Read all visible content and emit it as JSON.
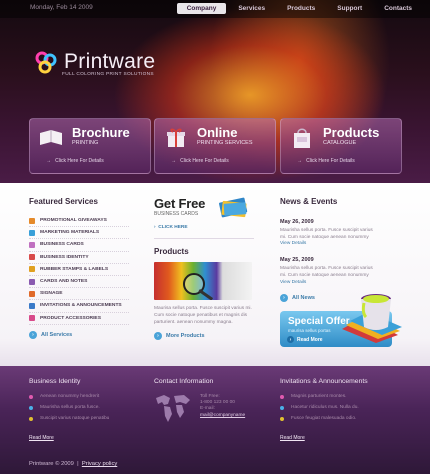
{
  "header": {
    "date": "Monday, Feb 14 2009",
    "nav": [
      "Company",
      "Services",
      "Products",
      "Support",
      "Contacts"
    ],
    "logo_name": "Printware",
    "logo_tagline": "FULL COLORING PRINT SOLUTIONS",
    "promos": [
      {
        "title": "Brochure",
        "subtitle": "PRINTING",
        "link": "Click Here For Details",
        "icon": "book-icon"
      },
      {
        "title": "Online",
        "subtitle": "PRINTING SERVICES",
        "link": "Click Here For Details",
        "icon": "gift-box-icon"
      },
      {
        "title": "Products",
        "subtitle": "CATALOGUE",
        "link": "Click Here For Details",
        "icon": "shopping-bag-icon"
      }
    ]
  },
  "featured": {
    "title": "Featured Services",
    "items": [
      {
        "label": "PROMOTIONAL GIVEAWAYS",
        "color": "#e58a2a"
      },
      {
        "label": "MARKETING MATERIALS",
        "color": "#3aa0d8"
      },
      {
        "label": "BUSINESS CARDS",
        "color": "#c070c0"
      },
      {
        "label": "BUSINESS IDENTITY",
        "color": "#d84a4a"
      },
      {
        "label": "RUBBER STAMPS & LABELS",
        "color": "#e0a020"
      },
      {
        "label": "CARDS AND NOTES",
        "color": "#8a5ab0"
      },
      {
        "label": "SIGNAGE",
        "color": "#e06a2a"
      },
      {
        "label": "INVITATIONS & ANNOUNCEMENTS",
        "color": "#3a7ac8"
      },
      {
        "label": "PRODUCT ACCESSORIES",
        "color": "#d84a8a"
      }
    ],
    "more": "All Services"
  },
  "getfree": {
    "title": "Get Free",
    "subtitle": "BUSINESS CARDS",
    "link": "CLICK HERE"
  },
  "products": {
    "title": "Products",
    "text": "Maurisa sellus porta. Fusce suscipit varius mi. Cum socie natoque penatibus et magnis dis parturient. aenean nonummy magna.",
    "more": "More Products"
  },
  "news": {
    "title": "News & Events",
    "items": [
      {
        "date": "May 26, 2009",
        "text": "Maurisha sellus porta. Fusce suscipit varius mi. Cum socie natoque aenean nonummy",
        "link": "View Details"
      },
      {
        "date": "May 25, 2009",
        "text": "Maurisha sellus porta. Fusce suscipit varius mi. Cum socie natoque aenean nonummy",
        "link": "View Details"
      }
    ],
    "more": "All News"
  },
  "special": {
    "title": "Special Offer",
    "subtitle": "maurisa sellus portas",
    "button": "Read More"
  },
  "footer": {
    "identity": {
      "title": "Business Identity",
      "items": [
        {
          "text": "Aenean nonummy hendrerit",
          "color": "#e05ab0"
        },
        {
          "text": "Maurisha sellus porta fusce.",
          "color": "#4ab0e8"
        },
        {
          "text": "Suscipit varius natoque penatibu",
          "color": "#e0c030"
        }
      ],
      "more": "Read More"
    },
    "contact": {
      "title": "Contact Information",
      "lines": [
        "Toll Free:",
        "1-800 123 00 00",
        "E-mail:",
        "mail@companyname"
      ]
    },
    "invitations": {
      "title": "Invitations & Announcements",
      "items": [
        {
          "text": "Magnis parturient montes.",
          "color": "#e05ab0"
        },
        {
          "text": "Hacetur ridiculus mus. Nulla du.",
          "color": "#4ab0e8"
        },
        {
          "text": "Fusce feugiat malesuada odio.",
          "color": "#e0c030"
        }
      ],
      "more": "Read More"
    },
    "copyright": "Printware © 2009",
    "privacy": "Privacy policy"
  }
}
